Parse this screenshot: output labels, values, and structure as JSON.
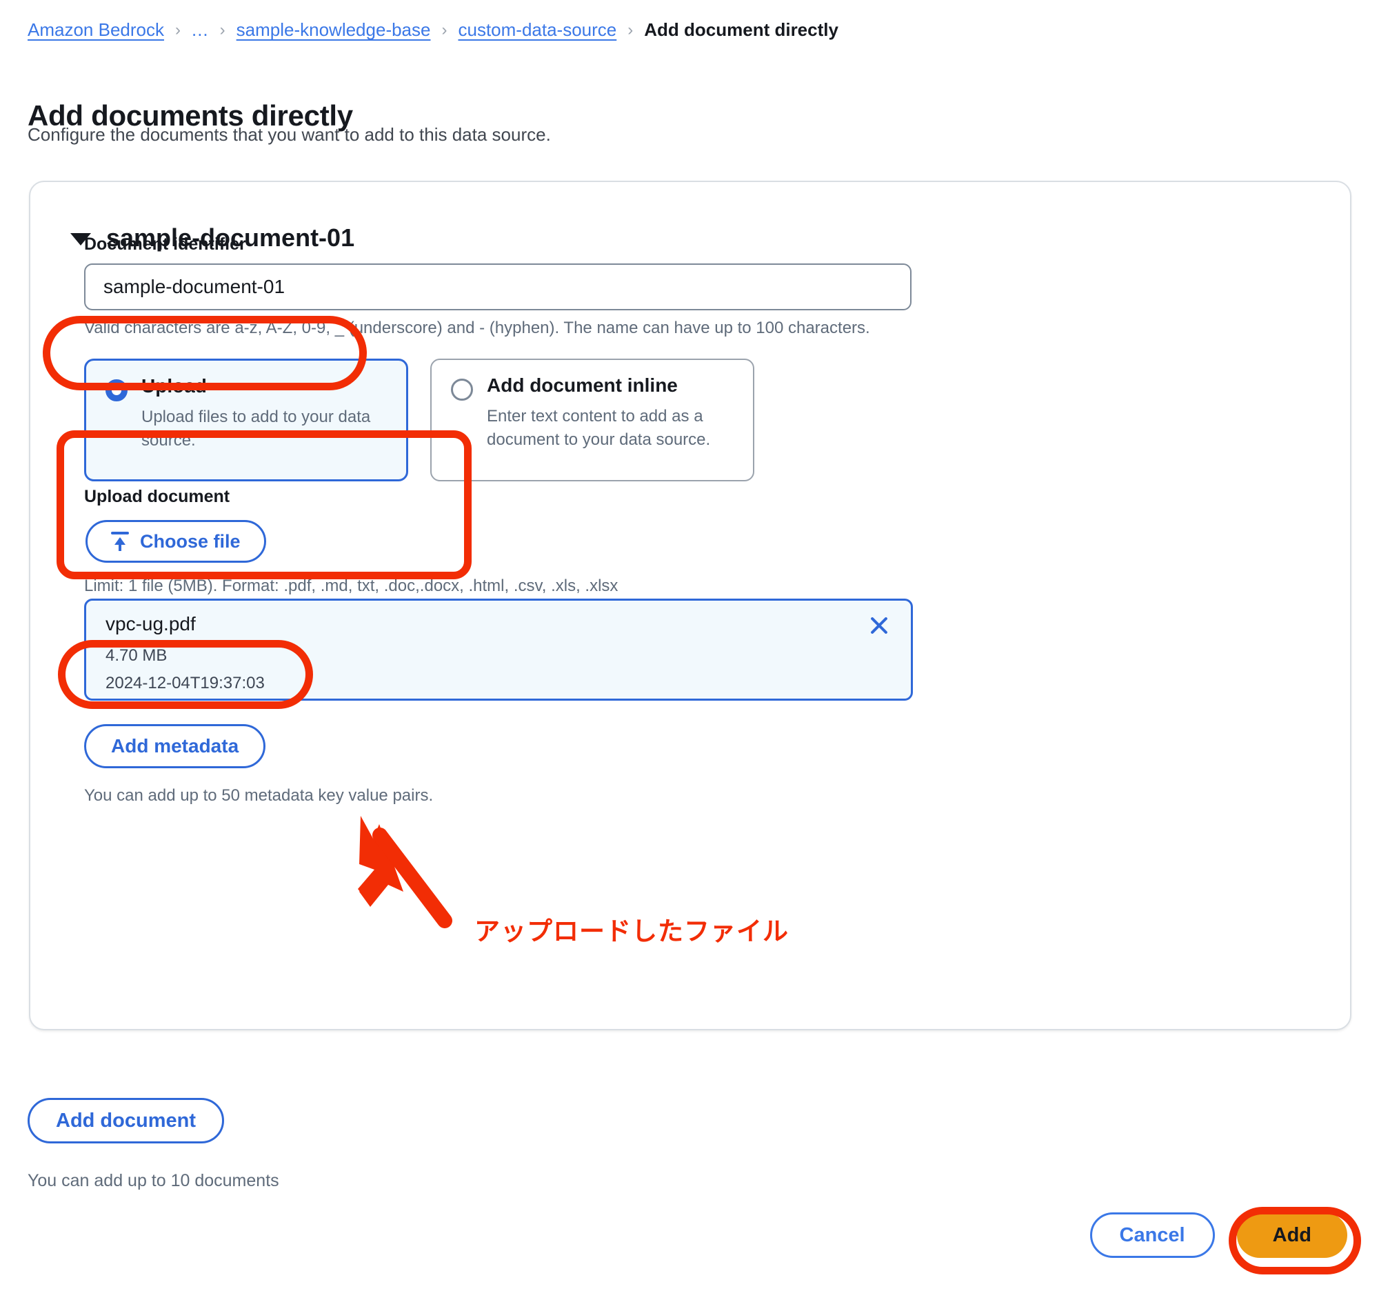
{
  "breadcrumb": {
    "items": [
      {
        "label": "Amazon Bedrock",
        "type": "link"
      },
      {
        "label": "...",
        "type": "link"
      },
      {
        "label": "sample-knowledge-base",
        "type": "link"
      },
      {
        "label": "custom-data-source",
        "type": "link"
      },
      {
        "label": "Add document directly",
        "type": "current"
      }
    ],
    "separator": "›"
  },
  "header": {
    "title": "Add documents directly",
    "subtitle": "Configure the documents that you want to add to this data source."
  },
  "document_card": {
    "expander_title": "sample-document-01",
    "identifier": {
      "label": "Document identifier",
      "value": "sample-document-01",
      "placeholder": "",
      "hint": "Valid characters are a-z, A-Z, 0-9, _ (underscore) and - (hyphen). The name can have up to 100 characters."
    },
    "source_options": [
      {
        "title": "Upload",
        "description": "Upload files to add to your data source.",
        "selected": true
      },
      {
        "title": "Add document inline",
        "description": "Enter text content to add as a document to your data source.",
        "selected": false
      }
    ],
    "upload": {
      "label": "Upload document",
      "choose_file_label": "Choose file",
      "choose_file_icon": "upload-icon",
      "limit_hint": "Limit: 1 file (5MB). Format: .pdf, .md, txt, .doc,.docx, .html, .csv, .xls, .xlsx",
      "file": {
        "name": "vpc-ug.pdf",
        "size": "4.70 MB",
        "timestamp": "2024-12-04T19:37:03",
        "remove_icon": "close-icon"
      }
    },
    "metadata": {
      "button_label": "Add metadata",
      "hint": "You can add up to 50 metadata key value pairs."
    }
  },
  "add_document": {
    "button_label": "Add document",
    "hint": "You can add up to 10 documents"
  },
  "footer": {
    "cancel_label": "Cancel",
    "add_label": "Add"
  },
  "annotation": {
    "callout_text": "アップロードしたファイル",
    "color": "#f22d05"
  },
  "colors": {
    "link": "#3b78e7",
    "accent_blue": "#2f68d8",
    "selected_tile_bg": "#f2f9fd",
    "primary_button": "#ee9a12",
    "annotation_red": "#f22d05",
    "text": "#16191f",
    "muted_text": "#5f6b7a"
  }
}
